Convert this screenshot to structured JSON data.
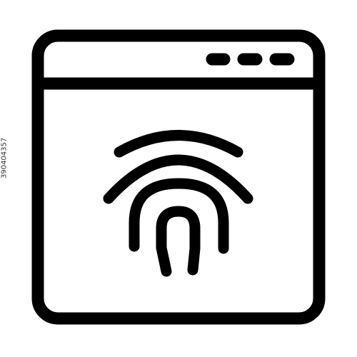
{
  "icon": {
    "name": "browser-fingerprint-icon",
    "stroke_color": "#000000",
    "background_color": "#ffffff"
  },
  "watermark": {
    "id_text": "390404357"
  }
}
